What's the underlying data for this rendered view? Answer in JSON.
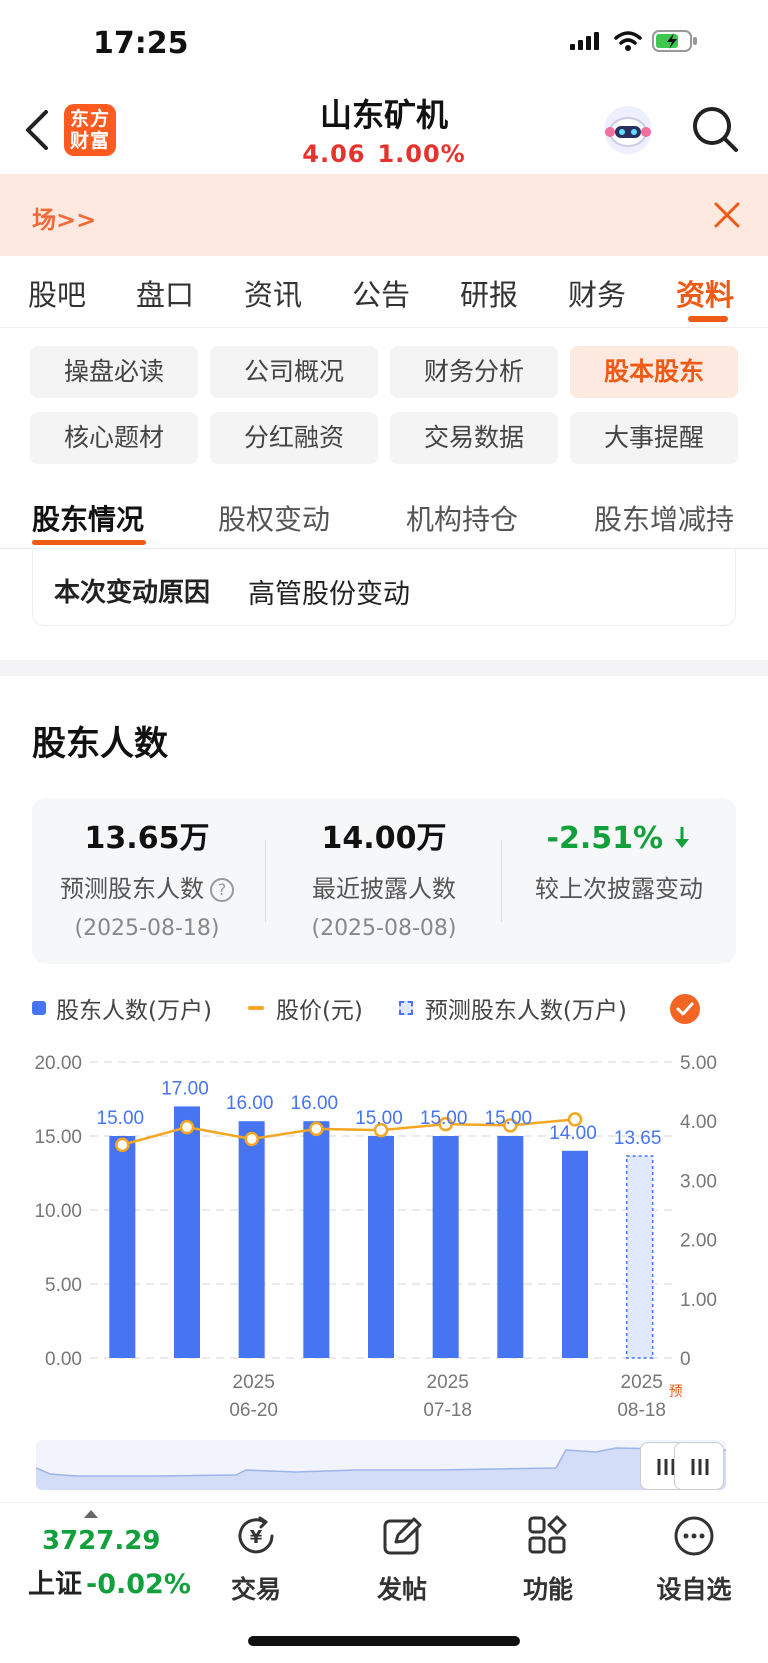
{
  "status": {
    "time": "17:25"
  },
  "header": {
    "logo_text_1": "东方",
    "logo_text_2": "财富",
    "stock_name": "山东矿机",
    "price": "4.06",
    "change_pct": "1.00%"
  },
  "banner": {
    "text": "场>>"
  },
  "main_tabs": [
    "股吧",
    "盘口",
    "资讯",
    "公告",
    "研报",
    "财务",
    "资料"
  ],
  "sub_tabs": [
    "操盘必读",
    "公司概况",
    "财务分析",
    "股本股东",
    "核心题材",
    "分红融资",
    "交易数据",
    "大事提醒"
  ],
  "section_tabs": [
    "股东情况",
    "股权变动",
    "机构持仓",
    "股东增减持"
  ],
  "reason": {
    "label": "本次变动原因",
    "value": "高管股份变动"
  },
  "section_title": "股东人数",
  "summary": [
    {
      "value": "13.65万",
      "label": "预测股东人数",
      "date": "(2025-08-18)"
    },
    {
      "value": "14.00万",
      "label": "最近披露人数",
      "date": "(2025-08-08)"
    },
    {
      "value": "-2.51%",
      "label": "较上次披露变动",
      "date": ""
    }
  ],
  "legend": {
    "bars": "股东人数(万户)",
    "price": "股价(元)",
    "forecast": "预测股东人数(万户)"
  },
  "colors": {
    "accent": "#ef5a17",
    "bar": "#4774f0",
    "line": "#f5a623",
    "up": "#e5322d",
    "down": "#12a03c"
  },
  "chart_data": {
    "type": "bar",
    "series": [
      {
        "name": "股东人数(万户)",
        "values": [
          15.0,
          17.0,
          16.0,
          16.0,
          15.0,
          15.0,
          15.0,
          14.0,
          13.65
        ]
      },
      {
        "name": "股价(元)",
        "values": [
          3.6,
          3.9,
          3.7,
          3.87,
          3.85,
          3.95,
          3.93,
          4.03
        ]
      }
    ],
    "value_labels": [
      "15.00",
      "17.00",
      "16.00",
      "16.00",
      "15.00",
      "15.00",
      "15.00",
      "14.00",
      "13.65"
    ],
    "forecast_index": 8,
    "ylim_left": [
      0,
      20
    ],
    "ylim_right": [
      0,
      5
    ],
    "left_ticks": [
      "0.00",
      "5.00",
      "10.00",
      "15.00",
      "20.00"
    ],
    "right_ticks": [
      "0",
      "1.00",
      "2.00",
      "3.00",
      "4.00",
      "5.00"
    ],
    "x_ticks": [
      {
        "index": 2,
        "year": "2025",
        "date": "06-20"
      },
      {
        "index": 5,
        "year": "2025",
        "date": "07-18"
      },
      {
        "index": 8,
        "year": "2025",
        "date": "08-18"
      }
    ],
    "forecast_mark": "预"
  },
  "bottom": {
    "index_value": "3727.29",
    "index_name": "上证",
    "index_change": "-0.02%",
    "nav": [
      "交易",
      "发帖",
      "功能",
      "设自选"
    ]
  }
}
